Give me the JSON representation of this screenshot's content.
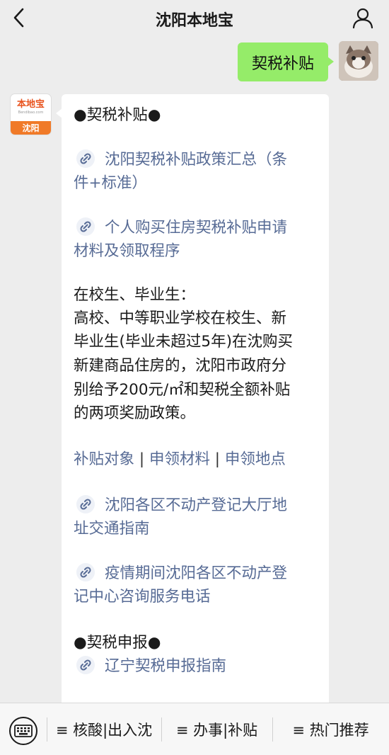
{
  "header": {
    "title": "沈阳本地宝"
  },
  "sent_message": {
    "text": "契税补贴"
  },
  "bot": {
    "avatar_brand": "本地宝",
    "avatar_domain": "Bendibao.com",
    "avatar_city": "沈阳"
  },
  "reply": {
    "section1_title": "●契税补贴●",
    "link1_line1": "沈阳契税补贴政策汇总（条",
    "link1_line2": "件+标准）",
    "link2_line1": "个人购买住房契税补贴申请",
    "link2_line2": "材料及领取程序",
    "para_heading": "在校生、毕业生：",
    "para_line1": "高校、中等职业学校在校生、新",
    "para_line2": "毕业生(毕业未超过5年)在沈购买",
    "para_line3": "新建商品住房的，沈阳市政府分",
    "para_line4": "别给予200元/㎡和契税全额补贴",
    "para_line5": "的两项奖励政策。",
    "quick_links": [
      "补贴对象",
      "申领材料",
      "申领地点"
    ],
    "quick_sep": " | ",
    "link3_line1": "沈阳各区不动产登记大厅地",
    "link3_line2": "址交通指南",
    "link4_line1": "疫情期间沈阳各区不动产登",
    "link4_line2": "记中心咨询服务电话",
    "section2_title": "●契税申报●",
    "link5_line1": "辽宁契税申报指南"
  },
  "bottom_menu": {
    "items": [
      "≡ 核酸|出入沈",
      "≡ 办事|补贴",
      "≡ 热门推荐"
    ]
  },
  "colors": {
    "sent_bubble": "#95ec69",
    "link": "#576b95",
    "background": "#ededed"
  },
  "icons": {
    "back": "chevron-left-icon",
    "user": "user-icon",
    "link": "link-icon",
    "keyboard": "keyboard-icon"
  }
}
